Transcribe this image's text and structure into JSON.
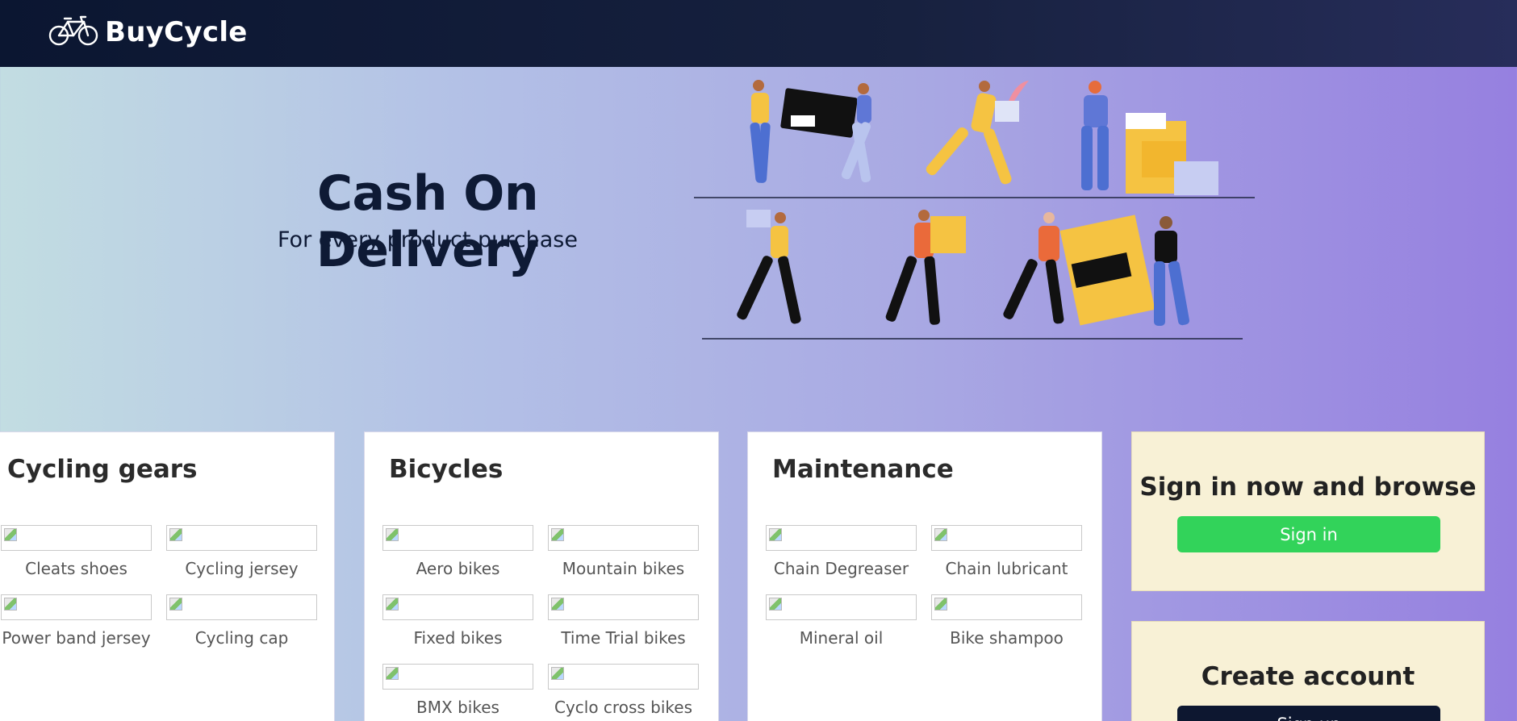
{
  "brand": {
    "name": "BuyCycle",
    "logo_icon": "bicycle-icon"
  },
  "hero": {
    "title": "Cash On Delivery",
    "subtitle": "For every product purchase"
  },
  "categories": [
    {
      "title": "Cycling gears",
      "items": [
        "Cleats shoes",
        "Cycling jersey",
        "Power band jersey",
        "Cycling cap"
      ]
    },
    {
      "title": "Bicycles",
      "items": [
        "Aero bikes",
        "Mountain bikes",
        "Fixed bikes",
        "Time Trial bikes",
        "BMX bikes",
        "Cyclo cross bikes"
      ]
    },
    {
      "title": "Maintenance",
      "items": [
        "Chain Degreaser",
        "Chain lubricant",
        "Mineral oil",
        "Bike shampoo"
      ]
    }
  ],
  "signin_panel": {
    "title": "Sign in now and browse",
    "button_label": "Sign in"
  },
  "signup_panel": {
    "title": "Create account",
    "button_label": "Sign up"
  },
  "colors": {
    "accent_green": "#32d35a",
    "header_dark": "#0b1631",
    "panel_bg": "#f8f1d6"
  }
}
